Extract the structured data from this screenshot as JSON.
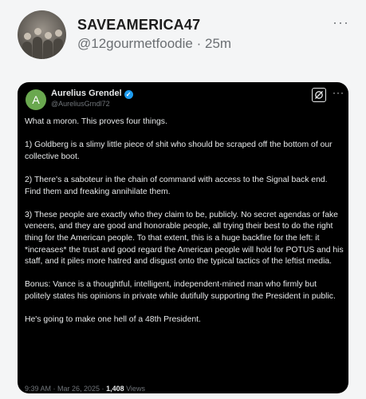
{
  "post": {
    "username": "SAVEAMERICA47",
    "handle": "@12gourmetfoodie",
    "separator": "·",
    "time": "25m",
    "more": "···"
  },
  "embedded": {
    "avatar_letter": "A",
    "name": "Aurelius Grendel",
    "verified_icon": "verified-badge-icon",
    "handle": "@AureliusGrndl72",
    "more": "···",
    "paragraphs": [
      "What a moron. This proves four things.",
      "1) Goldberg is a slimy little piece of shit who should be scraped off the bottom of our collective boot.",
      "2) There's a saboteur in the chain of command with access to the Signal back end. Find them and freaking annihilate them.",
      "3) These people are exactly who they claim to be, publicly. No secret agendas or fake veneers, and they are good and honorable people, all trying their best to do the right thing for the American people. To that extent, this is a huge backfire for the left: it *increases* the trust and good regard the American people will hold for POTUS and his staff, and it piles more hatred and disgust onto the typical tactics of the leftist media.",
      "Bonus: Vance is a thoughtful, intelligent, independent-mined man who firmly but politely states his opinions in private while dutifully supporting the President in public.",
      "He's going to make one hell of a 48th President."
    ],
    "footer_time": "9:39 AM · Mar 26, 2025 · ",
    "views_count": "1,408",
    "views_label": " Views"
  },
  "colors": {
    "card_bg": "#000000",
    "verified": "#1d9bf0",
    "avatar_green": "#6aa84f"
  }
}
